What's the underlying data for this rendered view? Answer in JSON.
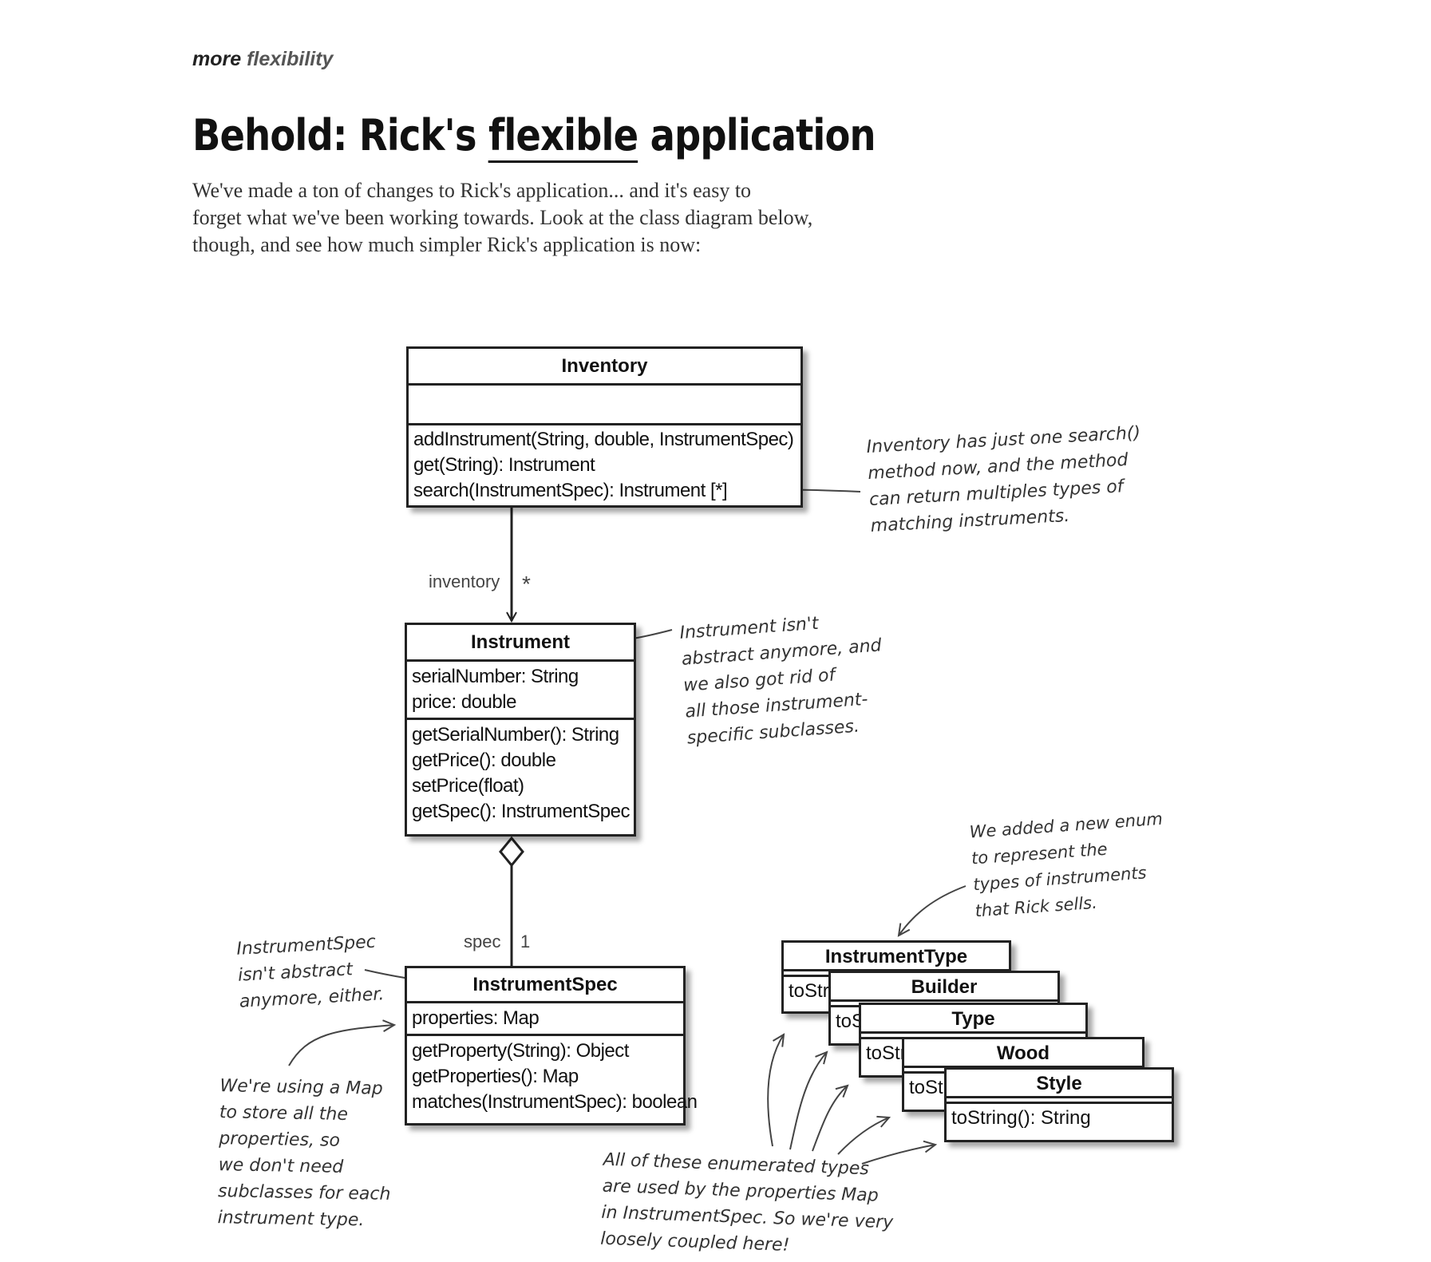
{
  "header": {
    "kicker_1": "more",
    "kicker_2": "flexibility",
    "title_before": "Behold: Rick's ",
    "title_underlined": "flexible",
    "title_after": " application",
    "intro": [
      "We've made a ton of changes to Rick's application... and it's easy to",
      "forget what we've been working towards. Look at the class diagram below,",
      "though, and see how much simpler Rick's application is now:"
    ]
  },
  "classes": {
    "inventory": {
      "name": "Inventory",
      "attributes": [],
      "methods": [
        "addInstrument(String, double, InstrumentSpec)",
        "get(String): Instrument",
        "search(InstrumentSpec): Instrument [*]"
      ]
    },
    "instrument": {
      "name": "Instrument",
      "attributes": [
        "serialNumber: String",
        "price: double"
      ],
      "methods": [
        "getSerialNumber(): String",
        "getPrice(): double",
        "setPrice(float)",
        "getSpec(): InstrumentSpec"
      ]
    },
    "instrument_spec": {
      "name": "InstrumentSpec",
      "attributes": [
        "properties: Map"
      ],
      "methods": [
        "getProperty(String): Object",
        "getProperties(): Map",
        "matches(InstrumentSpec): boolean"
      ]
    }
  },
  "enums": [
    {
      "name": "InstrumentType",
      "visible_method": "toStri"
    },
    {
      "name": "Builder",
      "visible_method": "toS"
    },
    {
      "name": "Type",
      "visible_method": "toStr"
    },
    {
      "name": "Wood",
      "visible_method": "toSt"
    },
    {
      "name": "Style",
      "visible_method": "toString(): String"
    }
  ],
  "associations": {
    "inventory_role": "inventory",
    "inventory_mult": "*",
    "spec_role": "spec",
    "spec_mult": "1"
  },
  "annotations": {
    "inventory_note": [
      "Inventory has just one search()",
      "method now, and the method",
      "can return multiples types of",
      "matching instruments."
    ],
    "instrument_note": [
      "Instrument isn't",
      "abstract anymore, and",
      "we also got rid of",
      "all those instrument-",
      "specific subclasses."
    ],
    "enum_note": [
      "We added a new enum",
      "to represent the",
      "types of instruments",
      "that Rick sells."
    ],
    "spec_note": [
      "InstrumentSpec",
      "isn't abstract",
      "anymore, either."
    ],
    "map_note": [
      "We're using a Map",
      "to store all the",
      "properties, so",
      "we don't need",
      "subclasses for each",
      "instrument type."
    ],
    "coupling_note": [
      "All of these enumerated types",
      "are used by the properties Map",
      "in InstrumentSpec. So we're very",
      "loosely coupled here!"
    ]
  }
}
